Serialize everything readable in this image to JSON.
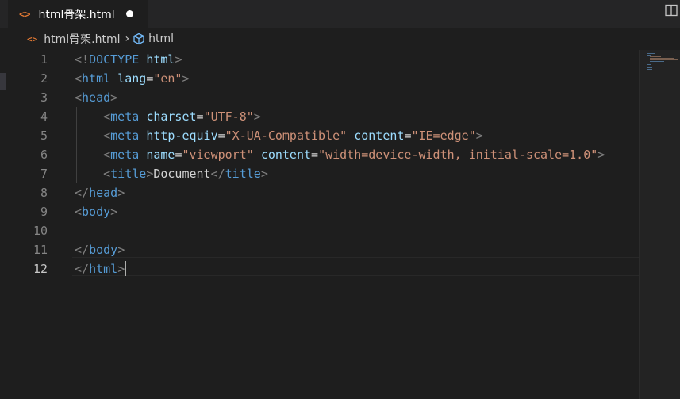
{
  "tab": {
    "icon": "<>",
    "filename": "html骨架.html",
    "dirty": true
  },
  "breadcrumb": {
    "file": "html骨架.html",
    "separator": "›",
    "symbol": "html"
  },
  "editor": {
    "active_line": 12,
    "lines": [
      {
        "num": "1"
      },
      {
        "num": "2"
      },
      {
        "num": "3"
      },
      {
        "num": "4"
      },
      {
        "num": "5"
      },
      {
        "num": "6"
      },
      {
        "num": "7"
      },
      {
        "num": "8"
      },
      {
        "num": "9"
      },
      {
        "num": "10"
      },
      {
        "num": "11"
      },
      {
        "num": "12"
      }
    ],
    "tokens": {
      "l1": [
        "<!",
        "DOCTYPE",
        " ",
        "html",
        ">"
      ],
      "l2": [
        "<",
        "html",
        " ",
        "lang",
        "=",
        "\"en\"",
        ">"
      ],
      "l3": [
        "<",
        "head",
        ">"
      ],
      "l4": [
        "    ",
        "<",
        "meta",
        " ",
        "charset",
        "=",
        "\"UTF-8\"",
        ">"
      ],
      "l5": [
        "    ",
        "<",
        "meta",
        " ",
        "http-equiv",
        "=",
        "\"X-UA-Compatible\"",
        " ",
        "content",
        "=",
        "\"IE=edge\"",
        ">"
      ],
      "l6": [
        "    ",
        "<",
        "meta",
        " ",
        "name",
        "=",
        "\"viewport\"",
        " ",
        "content",
        "=",
        "\"width=device-width, initial-scale=1.0\"",
        ">"
      ],
      "l7": [
        "    ",
        "<",
        "title",
        ">",
        "Document",
        "</",
        "title",
        ">"
      ],
      "l8": [
        "</",
        "head",
        ">"
      ],
      "l9": [
        "<",
        "body",
        ">"
      ],
      "l10": [
        ""
      ],
      "l11": [
        "</",
        "body",
        ">"
      ],
      "l12": [
        "</",
        "html",
        ">"
      ]
    }
  },
  "colors": {
    "background": "#1e1e1e",
    "tag": "#569cd6",
    "attribute": "#9cdcfe",
    "string": "#ce9178",
    "punctuation": "#808080",
    "text": "#d4d4d4",
    "file_icon": "#e37933"
  },
  "icons": {
    "tab": "html-file-icon",
    "split": "split-editor-icon",
    "symbol": "symbol-element-icon",
    "dirty": "unsaved-dot-icon"
  }
}
